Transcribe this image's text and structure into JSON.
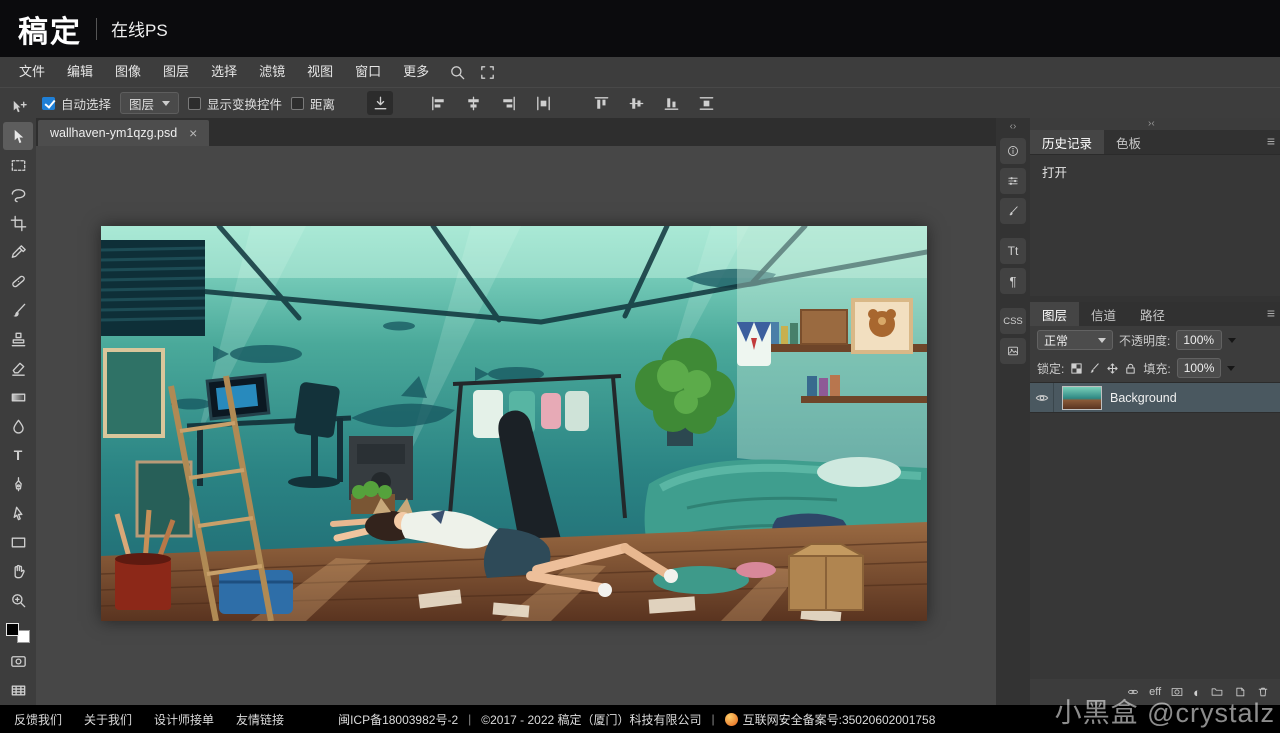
{
  "header": {
    "logo": "稿定",
    "product": "在线PS"
  },
  "menubar": {
    "items": [
      "文件",
      "编辑",
      "图像",
      "图层",
      "选择",
      "滤镜",
      "视图",
      "窗口",
      "更多"
    ]
  },
  "options": {
    "auto_select": "自动选择",
    "target": "图层",
    "show_transform": "显示变换控件",
    "distance": "距离"
  },
  "document": {
    "tab_title": "wallhaven-ym1qzg.psd"
  },
  "panels": {
    "history": {
      "tab": "历史记录",
      "swatches_tab": "色板",
      "entries": [
        "打开"
      ]
    },
    "layers": {
      "tab": "图层",
      "channels_tab": "信道",
      "paths_tab": "路径",
      "blend_mode": "正常",
      "opacity_label": "不透明度:",
      "opacity_value": "100%",
      "lock_label": "锁定:",
      "fill_label": "填充:",
      "fill_value": "100%",
      "layer_name": "Background"
    }
  },
  "footer": {
    "links": [
      "反馈我们",
      "关于我们",
      "设计师接单",
      "友情链接"
    ],
    "icp": "闽ICP备18003982号-2",
    "separator": "|",
    "copyright": "©2017 - 2022 稿定（厦门）科技有限公司",
    "security": "互联网安全备案号:35020602001758"
  },
  "watermark": "小黑盒 @crystalz",
  "icons": {
    "close": "×",
    "menu": "≡",
    "paragraph": "¶",
    "text_styles": "Tt",
    "css": "CSS",
    "adjustment": "◐",
    "type_tool": "T",
    "effects": "eff",
    "collapse_left": "‹›",
    "collapse_right": "›‹"
  }
}
